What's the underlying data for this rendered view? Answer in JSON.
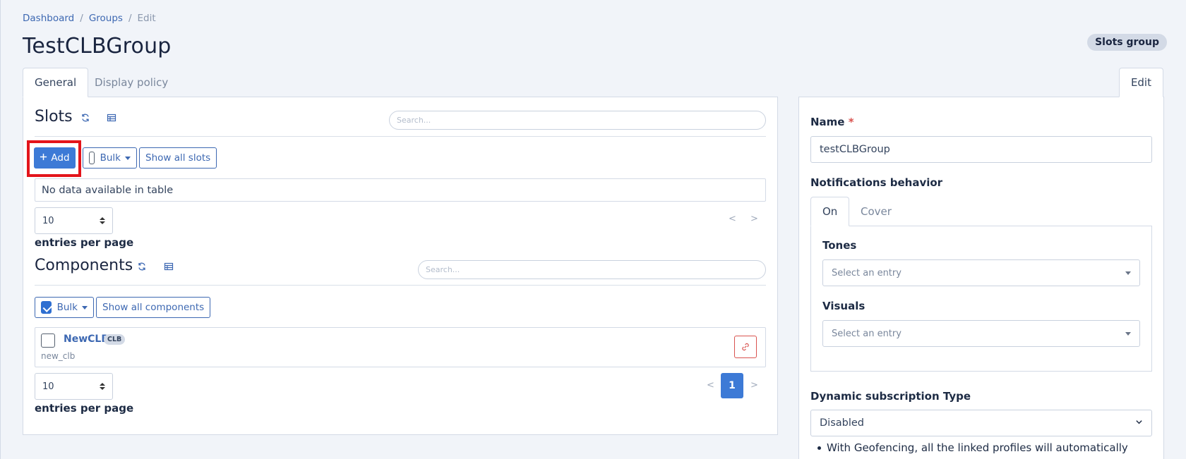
{
  "breadcrumb": {
    "items": [
      "Dashboard",
      "Groups"
    ],
    "separator": "/",
    "current": "Edit"
  },
  "page": {
    "title": "TestCLBGroup",
    "type_badge": "Slots group"
  },
  "tabs": {
    "general": "General",
    "display_policy": "Display policy",
    "edit": "Edit"
  },
  "slots": {
    "title": "Slots",
    "search_placeholder": "Search...",
    "add_label": "Add",
    "add_icon": "plus-icon",
    "bulk_label": "Bulk",
    "show_all_label": "Show all slots",
    "empty_text": "No data available in table",
    "per_page_value": "10",
    "entries_label": "entries per page",
    "prev": "<",
    "next": ">"
  },
  "components": {
    "title": "Components",
    "search_placeholder": "Search...",
    "bulk_label": "Bulk",
    "bulk_checked": true,
    "show_all_label": "Show all components",
    "rows": [
      {
        "name": "NewCLB",
        "badge": "CLB",
        "sub": "new_clb"
      }
    ],
    "per_page_value": "10",
    "entries_label": "entries per page",
    "prev": "<",
    "current_page": "1",
    "next": ">"
  },
  "edit_form": {
    "name_label": "Name",
    "required_mark": "*",
    "name_value": "testCLBGroup",
    "notifications_label": "Notifications behavior",
    "subtabs": {
      "on": "On",
      "cover": "Cover"
    },
    "tones_label": "Tones",
    "tones_placeholder": "Select an entry",
    "visuals_label": "Visuals",
    "visuals_placeholder": "Select an entry",
    "dynamic_label": "Dynamic subscription Type",
    "dynamic_value": "Disabled",
    "note": "With Geofencing, all the linked profiles will automatically"
  },
  "colors": {
    "accent": "#3d7ad6",
    "link": "#3d68b2",
    "highlight": "#e3141b",
    "danger": "#d9534f",
    "background": "#f1f4f9"
  }
}
